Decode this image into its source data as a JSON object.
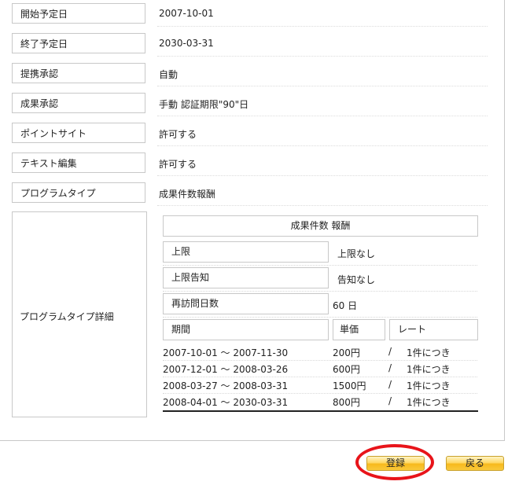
{
  "fields": [
    {
      "label": "開始予定日",
      "value": "2007-10-01"
    },
    {
      "label": "終了予定日",
      "value": "2030-03-31"
    },
    {
      "label": "提携承認",
      "value": "自動"
    },
    {
      "label": "成果承認",
      "value": "手動 認証期限\"90\"日"
    },
    {
      "label": "ポイントサイト",
      "value": "許可する"
    },
    {
      "label": "テキスト編集",
      "value": "許可する"
    },
    {
      "label": "プログラムタイプ",
      "value": "成果件数報酬"
    }
  ],
  "detail": {
    "label": "プログラムタイプ詳細",
    "title": "成果件数 報酬",
    "limit_label": "上限",
    "limit_value": "上限なし",
    "notice_label": "上限告知",
    "notice_value": "告知なし",
    "revisit_label": "再訪問日数",
    "revisit_value": "60 日",
    "columns": {
      "period": "期間",
      "price": "単価",
      "rate": "レート"
    },
    "rows": [
      {
        "period": "2007-10-01 ～ 2007-11-30",
        "price": "200円",
        "slash": "/",
        "rate": "1件につき"
      },
      {
        "period": "2007-12-01 ～ 2008-03-26",
        "price": "600円",
        "slash": "/",
        "rate": "1件につき"
      },
      {
        "period": "2008-03-27 ～ 2008-03-31",
        "price": "1500円",
        "slash": "/",
        "rate": "1件につき"
      },
      {
        "period": "2008-04-01 ～ 2030-03-31",
        "price": "800円",
        "slash": "/",
        "rate": "1件につき"
      }
    ]
  },
  "buttons": {
    "register": "登録",
    "back": "戻る"
  },
  "colors": {
    "highlight_circle": "#e8141a",
    "button_gold": "#f7b91c"
  }
}
